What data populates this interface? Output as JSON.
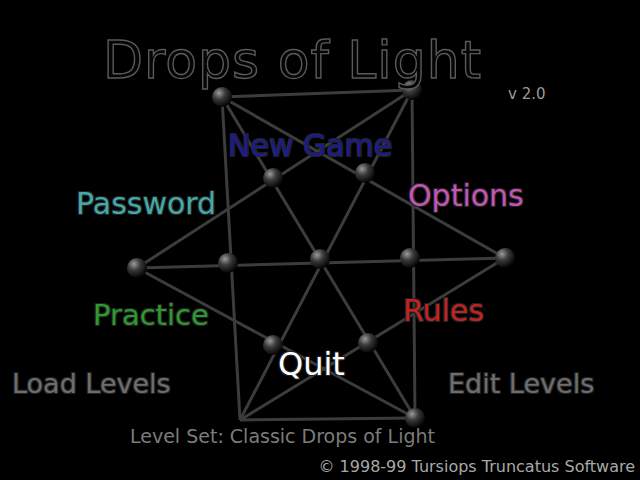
{
  "window": {
    "title": "Drops of Light",
    "version": "v 2.0"
  },
  "menu": [
    {
      "label": "New Game",
      "color": "#1c1c8e"
    },
    {
      "label": "Password",
      "color": "#45a9a9"
    },
    {
      "label": "Options",
      "color": "#c455b4"
    },
    {
      "label": "Practice",
      "color": "#2e9a2e"
    },
    {
      "label": "Rules",
      "color": "#c42222"
    },
    {
      "label": "Quit",
      "color": "#ffffff"
    },
    {
      "label": "Load Levels",
      "color": "#6e6e6e"
    },
    {
      "label": "Edit Levels",
      "color": "#6e6e6e"
    }
  ],
  "level_set": "Level Set: Classic Drops of Light",
  "copyright": "© 1998-99 Tursiops Truncatus Software"
}
